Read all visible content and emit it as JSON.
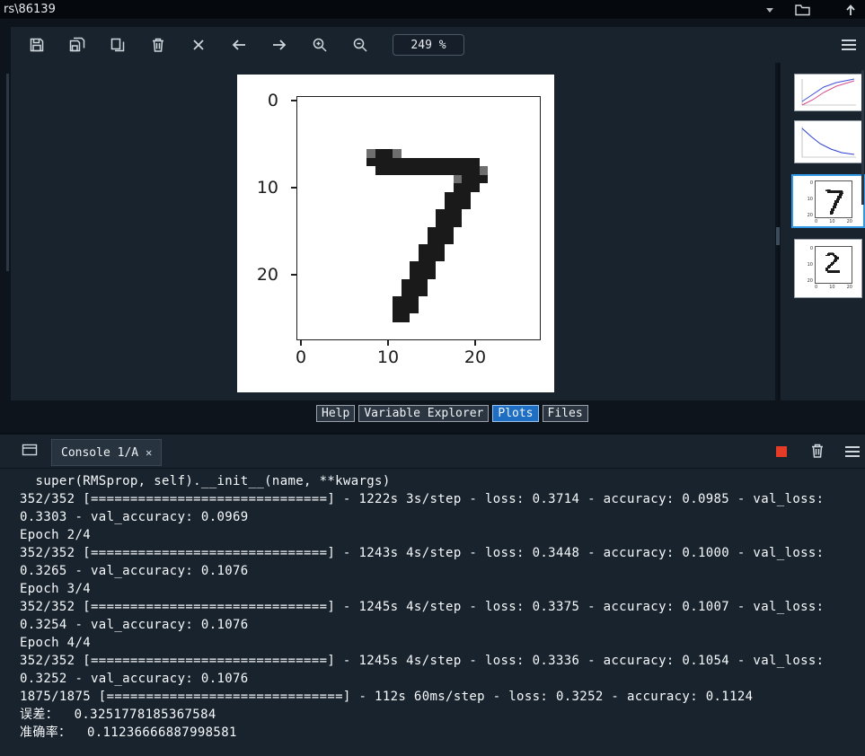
{
  "topbar": {
    "path": "rs\\86139"
  },
  "toolbar": {
    "zoom_level": "249 %",
    "buttons": [
      "save",
      "save-all",
      "copy",
      "remove",
      "remove-all",
      "previous",
      "next",
      "zoom-in",
      "zoom-out"
    ]
  },
  "figure": {
    "xticks": [
      "0",
      "10",
      "20"
    ],
    "yticks": [
      "0",
      "10",
      "20"
    ],
    "image_rows": [
      "............................",
      "............................",
      "............................",
      "............................",
      "............................",
      "............................",
      "........+##+................",
      "........#############.......",
      ".........############+......",
      "..................+###......",
      "..................###.......",
      ".................###........",
      ".................###........",
      "................###.........",
      "................###.........",
      "...............###..........",
      "...............###..........",
      "..............###...........",
      "..............###...........",
      ".............###............",
      ".............###............",
      "............###.............",
      "............###.............",
      "...........###..............",
      "...........###..............",
      "...........##...............",
      "............................",
      "............................"
    ]
  },
  "digit2_rows": [
    "............................",
    "............................",
    "............................",
    "............................",
    "..........++++..............",
    ".........######.............",
    "........###..###............",
    "..............###...........",
    "...............###..........",
    "...............###..........",
    "..............###...........",
    ".............###............",
    "............###.............",
    "...........###..............",
    "..........###...............",
    ".........###................",
    "........###.................",
    "........##..................",
    "........###########.........",
    ".........##########.........",
    "............................",
    "............................",
    "............................",
    "............................",
    "............................",
    "............................",
    "............................",
    "............................"
  ],
  "thumbnails": [
    {
      "name": "training-metrics-line-chart",
      "selected": false
    },
    {
      "name": "loss-curve",
      "selected": false
    },
    {
      "name": "digit-7",
      "selected": true
    },
    {
      "name": "digit-2",
      "selected": false
    }
  ],
  "pane_tabs": [
    {
      "label": "Help",
      "selected": false
    },
    {
      "label": "Variable Explorer",
      "selected": false
    },
    {
      "label": "Plots",
      "selected": true
    },
    {
      "label": "Files",
      "selected": false
    }
  ],
  "console": {
    "tab_label": "Console 1/A",
    "close_glyph": "✕",
    "lines": [
      "  super(RMSprop, self).__init__(name, **kwargs)",
      "352/352 [==============================] - 1222s 3s/step - loss: 0.3714 - accuracy: 0.0985 - val_loss:",
      "0.3303 - val_accuracy: 0.0969",
      "Epoch 2/4",
      "352/352 [==============================] - 1243s 4s/step - loss: 0.3448 - accuracy: 0.1000 - val_loss:",
      "0.3265 - val_accuracy: 0.1076",
      "Epoch 3/4",
      "352/352 [==============================] - 1245s 4s/step - loss: 0.3375 - accuracy: 0.1007 - val_loss:",
      "0.3254 - val_accuracy: 0.1076",
      "Epoch 4/4",
      "352/352 [==============================] - 1245s 4s/step - loss: 0.3336 - accuracy: 0.1054 - val_loss:",
      "0.3252 - val_accuracy: 0.1076",
      "1875/1875 [==============================] - 112s 60ms/step - loss: 0.3252 - accuracy: 0.1124",
      "误差：  0.3251778185367584",
      "准确率：  0.11236666887998581"
    ]
  },
  "colors": {
    "accent": "#2f9be8",
    "selected_tab": "#1e6fc4",
    "stop_red": "#e33b25"
  }
}
